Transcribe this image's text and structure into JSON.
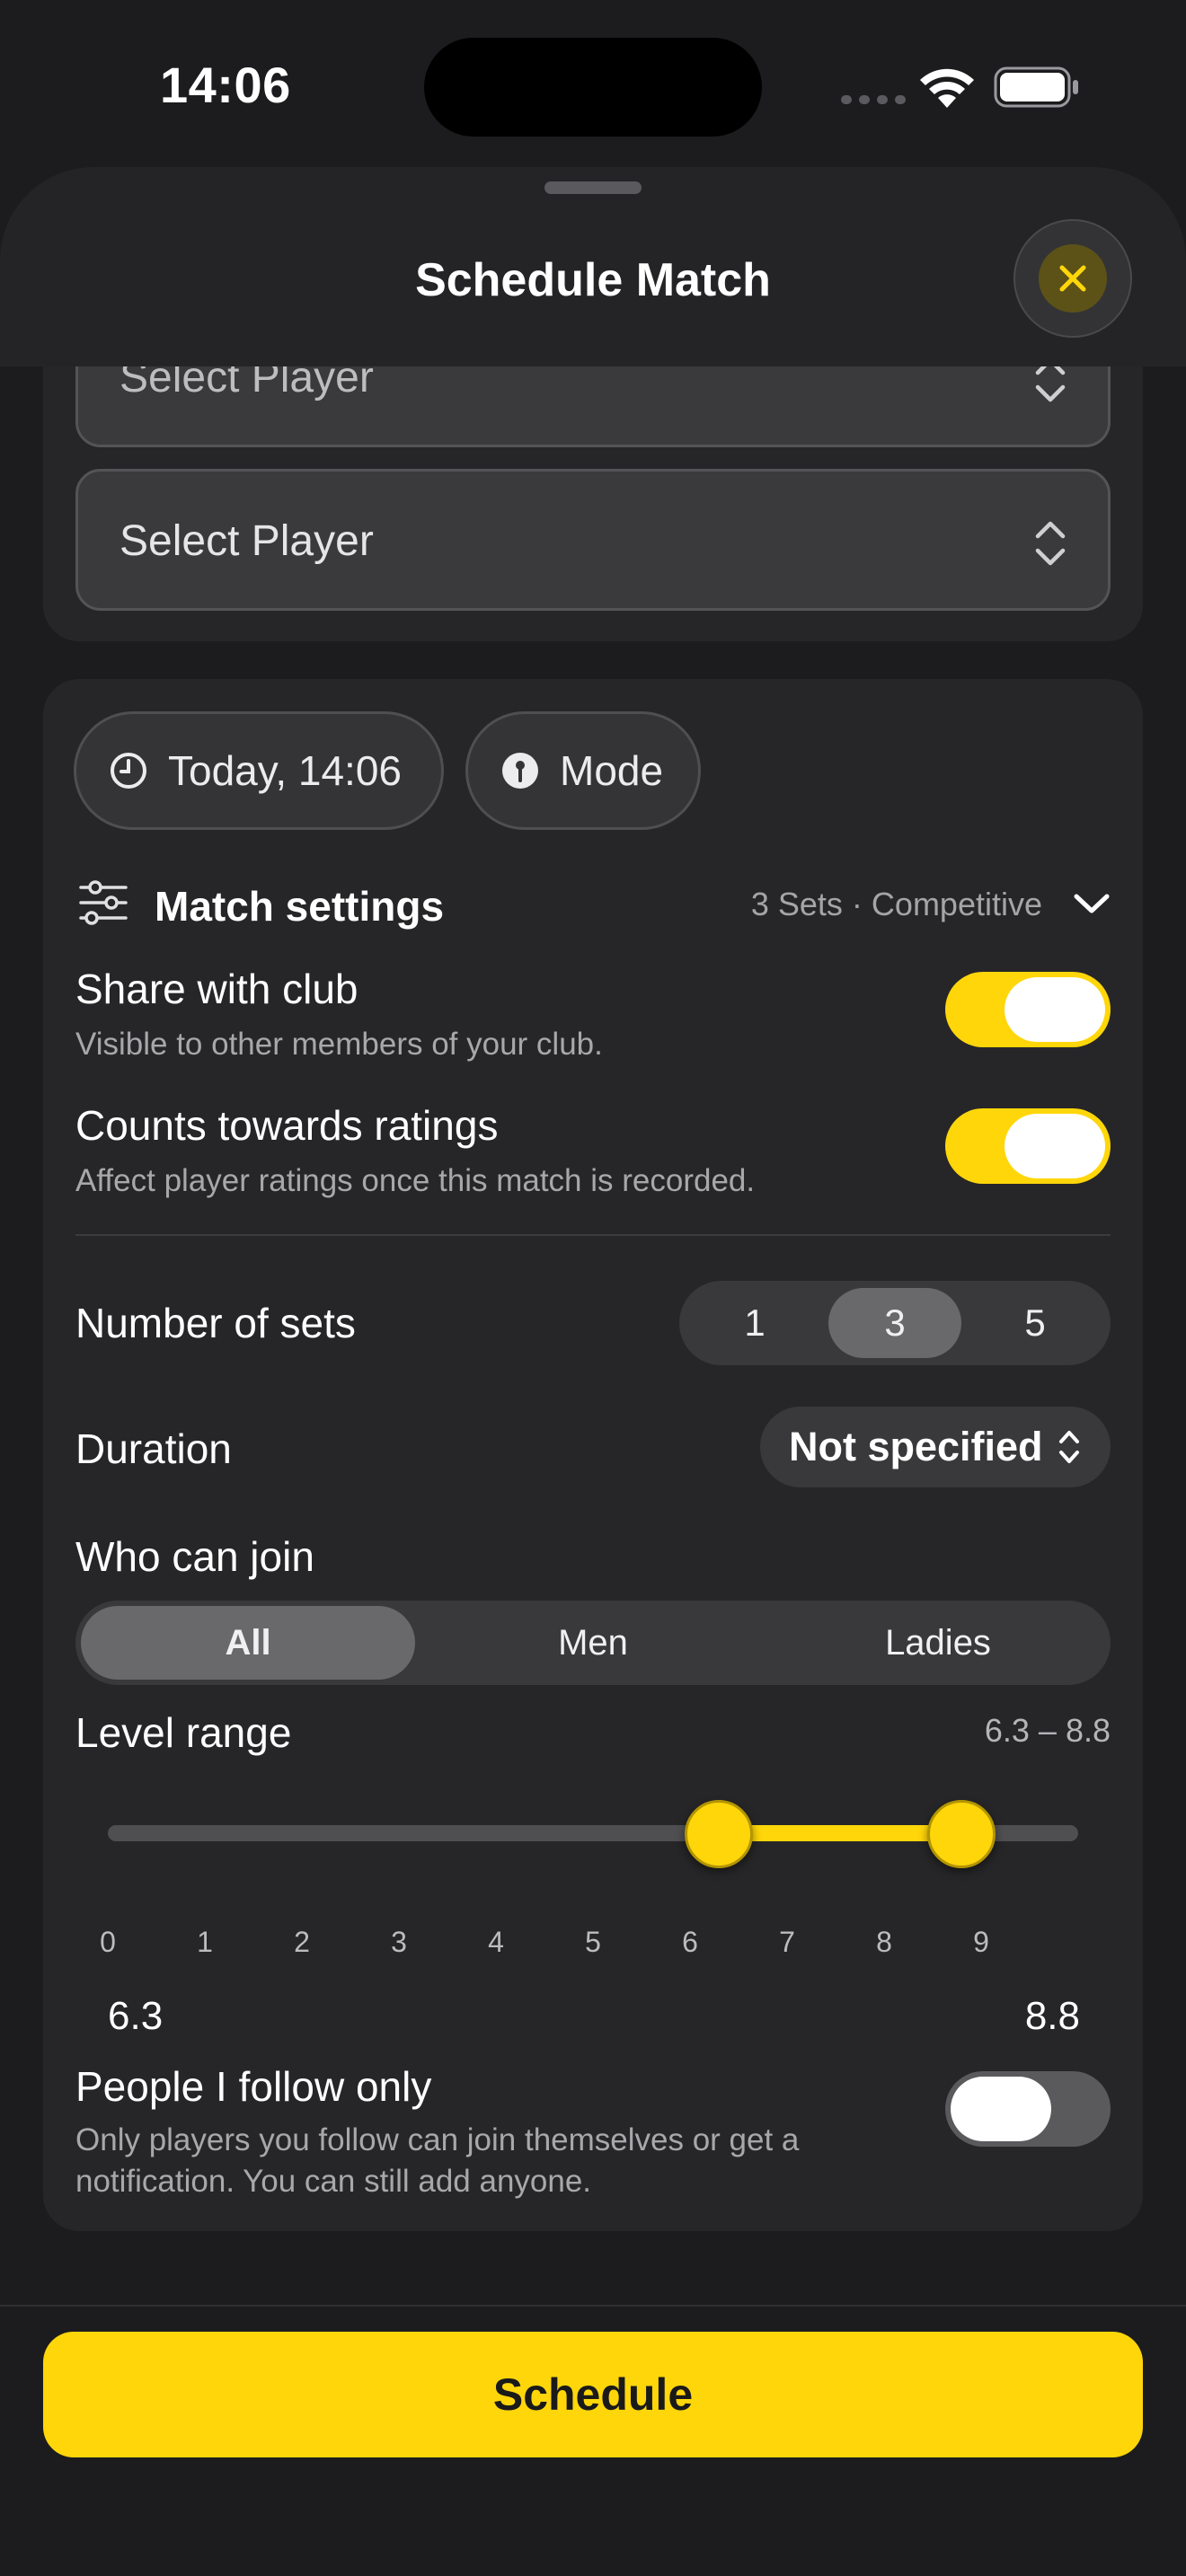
{
  "status_bar": {
    "time": "14:06"
  },
  "sheet": {
    "title": "Schedule Match"
  },
  "players": {
    "field_1_placeholder": "Select Player",
    "field_2_placeholder": "Select Player"
  },
  "quick_actions": {
    "time_label": "Today, 14:06",
    "mode_label": "Mode"
  },
  "match_settings": {
    "label": "Match settings",
    "summary": "3 Sets · Competitive"
  },
  "share_with_club": {
    "title": "Share with club",
    "subtitle": "Visible to other members of your club.",
    "enabled": true
  },
  "counts_towards_ratings": {
    "title": "Counts towards ratings",
    "subtitle": "Affect player ratings once this match is recorded.",
    "enabled": true
  },
  "number_of_sets": {
    "label": "Number of sets",
    "options": [
      "1",
      "3",
      "5"
    ],
    "selected": "3"
  },
  "duration": {
    "label": "Duration",
    "value": "Not specified"
  },
  "who_can_join": {
    "label": "Who can join",
    "options": [
      "All",
      "Men",
      "Ladies"
    ],
    "selected": "All"
  },
  "level_range": {
    "label": "Level range",
    "range_text": "6.3 – 8.8",
    "min": 0,
    "max": 10,
    "low": 6.3,
    "high": 8.8,
    "low_text": "6.3",
    "high_text": "8.8",
    "ticks": [
      "0",
      "1",
      "2",
      "3",
      "4",
      "5",
      "6",
      "7",
      "8",
      "9"
    ]
  },
  "people_i_follow": {
    "title": "People I follow only",
    "subtitle_line1": "Only players you follow can join themselves or get a",
    "subtitle_line2": "notification. You can still add anyone.",
    "enabled": false
  },
  "schedule_button": {
    "label": "Schedule"
  },
  "colors": {
    "accent": "#ffd60a",
    "background": "#1c1c1e",
    "card": "#262628"
  }
}
